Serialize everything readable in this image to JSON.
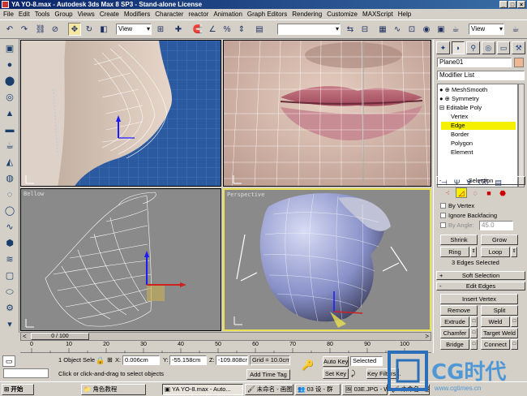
{
  "titlebar": {
    "title": "YA YO-8.max - Autodesk 3ds Max 8 SP3 - Stand-alone License",
    "min": "_",
    "max": "□",
    "close": "×"
  },
  "menu": [
    "File",
    "Edit",
    "Tools",
    "Group",
    "Views",
    "Create",
    "Modifiers",
    "Character",
    "reactor",
    "Animation",
    "Graph Editors",
    "Rendering",
    "Customize",
    "MAXScript",
    "Help"
  ],
  "toolbar": {
    "ref_coord": "View",
    "named_selection": "",
    "view_right": "View"
  },
  "viewports": {
    "top_left": {
      "label": ""
    },
    "top_right": {
      "label": ""
    },
    "bottom_left": {
      "label": "Bellow"
    },
    "bottom_right": {
      "label": "Perspective"
    }
  },
  "panel": {
    "object_name": "Plane01",
    "modifier_list": "Modifier List",
    "stack": [
      "MeshSmooth",
      "Symmetry",
      "Editable Poly",
      "Vertex",
      "Edge",
      "Border",
      "Polygon",
      "Element"
    ],
    "selection_rollout": "Selection",
    "by_vertex": "By Vertex",
    "ignore_backfacing": "Ignore Backfacing",
    "by_angle": "By Angle:",
    "by_angle_value": "45.0",
    "shrink": "Shrink",
    "grow": "Grow",
    "ring": "Ring",
    "loop": "Loop",
    "edges_selected": "3 Edges Selected",
    "soft_selection": "Soft Selection",
    "edit_edges": "Edit Edges",
    "insert_vertex": "Insert Vertex",
    "remove": "Remove",
    "split": "Split",
    "extrude": "Extrude",
    "weld": "Weld",
    "chamfer": "Chamfer",
    "target_weld": "Target Weld",
    "bridge": "Bridge",
    "connect": "Connect"
  },
  "timeline": {
    "frame_label": "0 / 100",
    "ticks": [
      "0",
      "10",
      "20",
      "30",
      "40",
      "50",
      "60",
      "70",
      "80",
      "90",
      "100"
    ]
  },
  "status": {
    "selected": "1 Object Sele",
    "prompt": "Click or click-and-drag to select objects",
    "x_label": "X:",
    "x_value": "0.006cm",
    "y_label": "Y:",
    "y_value": "-55.158cm",
    "z_label": "Z:",
    "z_value": "-109.808cr",
    "grid": "Grid = 10.0cm",
    "add_time_tag": "Add Time Tag",
    "auto_key": "Auto Key",
    "set_key": "Set Key",
    "selected_dropdown": "Selected",
    "key_filters": "Key Filters..."
  },
  "taskbar": {
    "start": "开始",
    "items": [
      "角色教程",
      "YA YO-8.max - Auto...",
      "未命名 - 画图",
      "03 设 - 群",
      "03E.JPG - Windows ...",
      "未命名 - 画图"
    ]
  },
  "watermark": {
    "brand": "CG时代",
    "url": "www.cgtimes.cn"
  },
  "colors": {
    "title_bar": "#0a246a",
    "selection_highlight": "#f4f000",
    "active_viewport_border": "#e8e050",
    "viewport_blue": "#2c5aa0"
  }
}
